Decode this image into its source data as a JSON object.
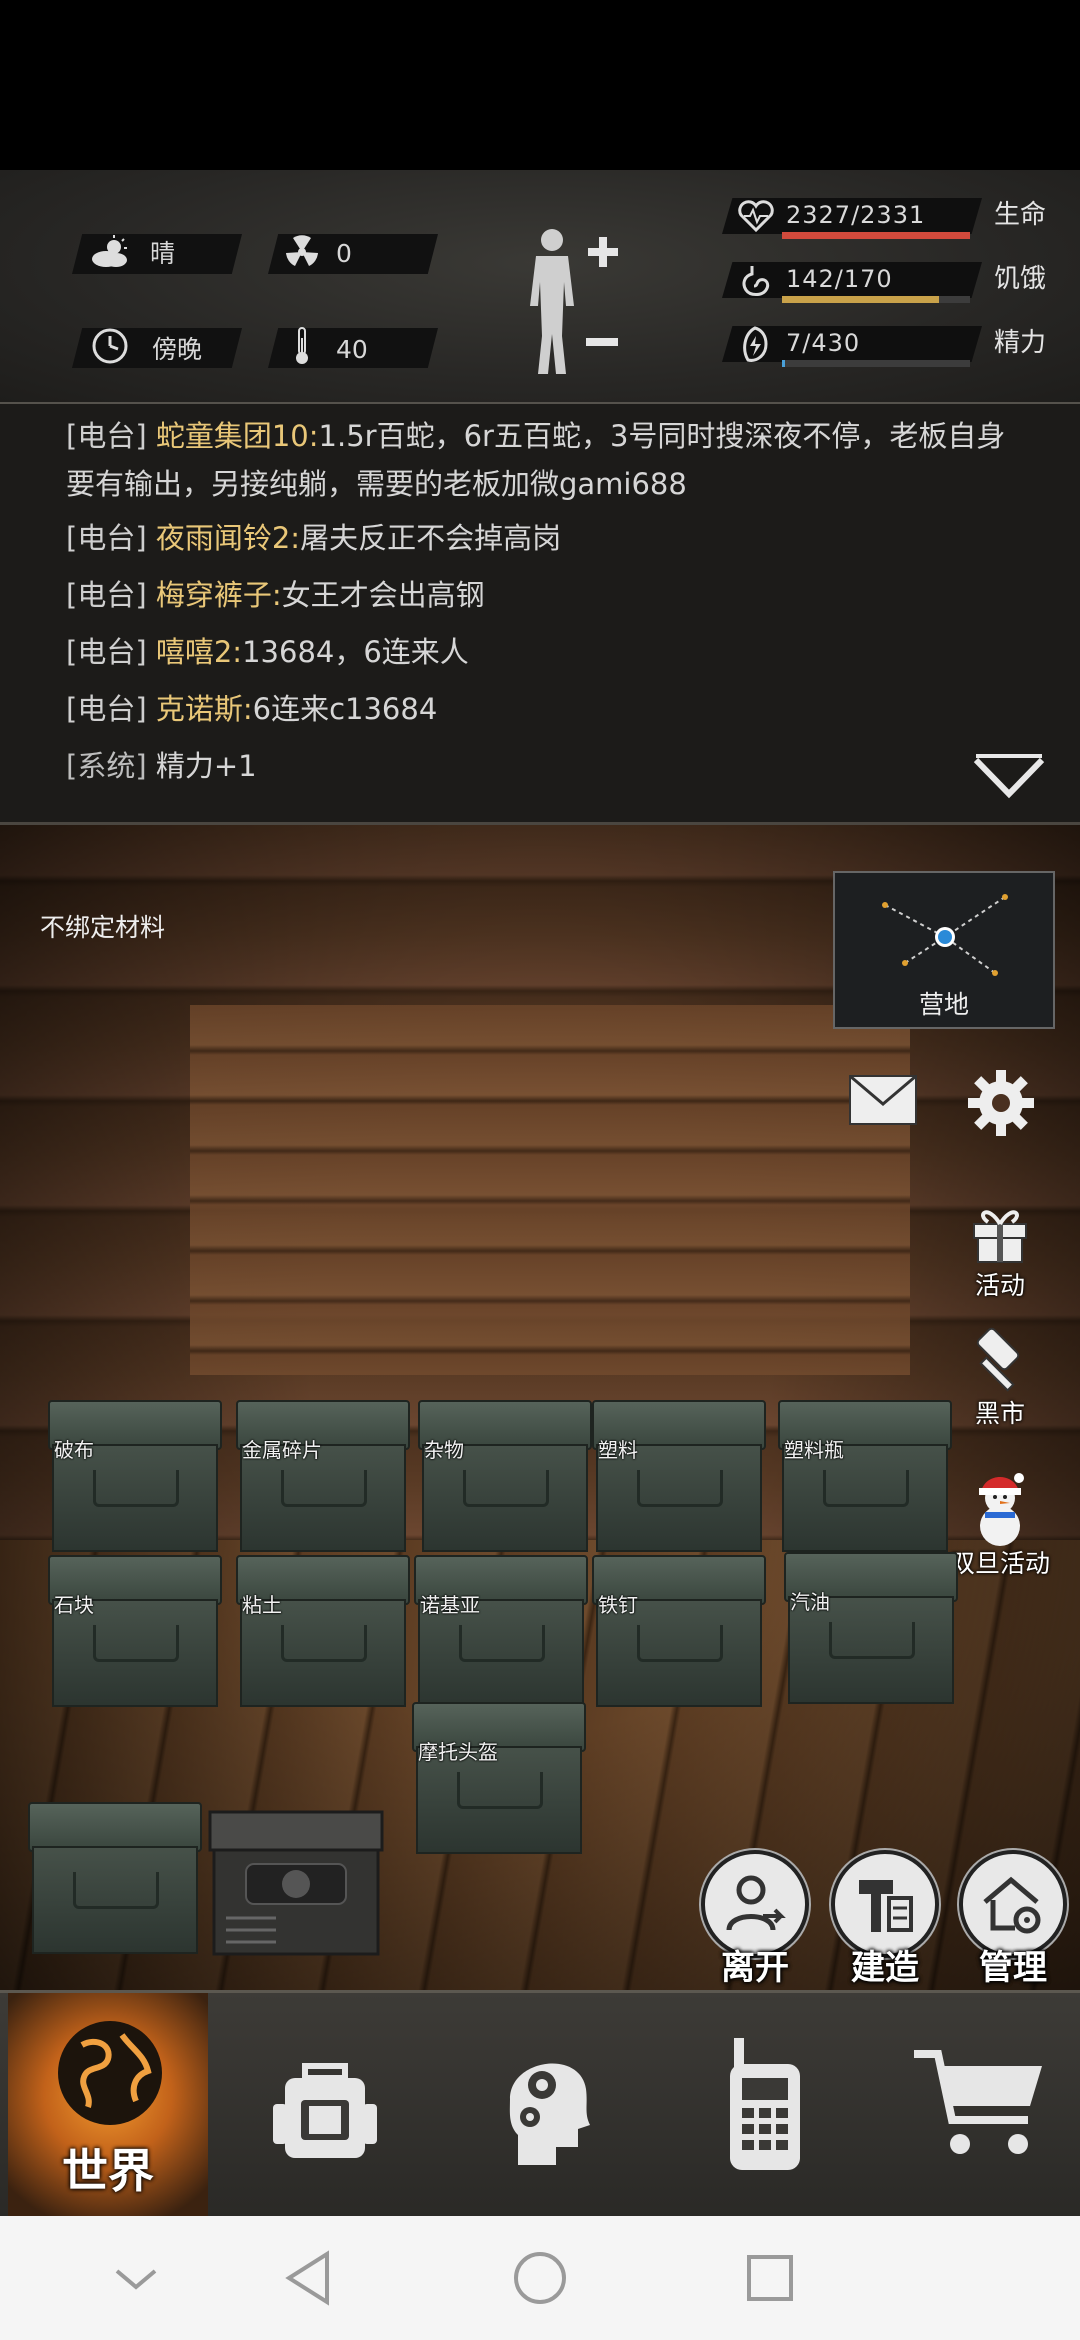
{
  "stats": {
    "weather": "晴",
    "radiation": "0",
    "time_of_day": "傍晚",
    "temperature": "40",
    "health": {
      "value": "2327/2331",
      "label": "生命",
      "fraction": 0.998,
      "color": "#d24a3c"
    },
    "hunger": {
      "value": "142/170",
      "label": "饥饿",
      "fraction": 0.835,
      "color": "#c9a24a"
    },
    "energy": {
      "value": "7/430",
      "label": "精力",
      "fraction": 0.016,
      "color": "#4aa0d8"
    }
  },
  "chat": [
    {
      "tag": "[电台]",
      "name": "蛇童集团10:",
      "text": "1.5r百蛇，6r五百蛇，3号同时搜深夜不停，老板自身要有输出，另接纯躺，需要的老板加微gami688"
    },
    {
      "tag": "[电台]",
      "name": "夜雨闻铃2:",
      "text": "屠夫反正不会掉高岗"
    },
    {
      "tag": "[电台]",
      "name": "梅穿裤子:",
      "text": "女王才会出高钢"
    },
    {
      "tag": "[电台]",
      "name": "嘻嘻2:",
      "text": "13684，6连来人"
    },
    {
      "tag": "[电台]",
      "name": "克诺斯:",
      "text": "6连来c13684"
    },
    {
      "tag": "[系统]",
      "name": "",
      "text": "精力+1"
    }
  ],
  "room": {
    "title": "不绑定材料",
    "camp_label": "营地",
    "side_buttons": {
      "activity": "活动",
      "black_market": "黑市",
      "new_year": "双旦活动"
    },
    "crates_row1": [
      "破布",
      "金属碎片",
      "杂物",
      "塑料",
      "塑料瓶"
    ],
    "crates_row2": [
      "石块",
      "粘土",
      "诺基亚",
      "铁钉",
      "汽油"
    ],
    "crate_row3": "摩托头盔",
    "actions": {
      "leave": "离开",
      "build": "建造",
      "manage": "管理"
    }
  },
  "nav": {
    "world": "世界"
  }
}
